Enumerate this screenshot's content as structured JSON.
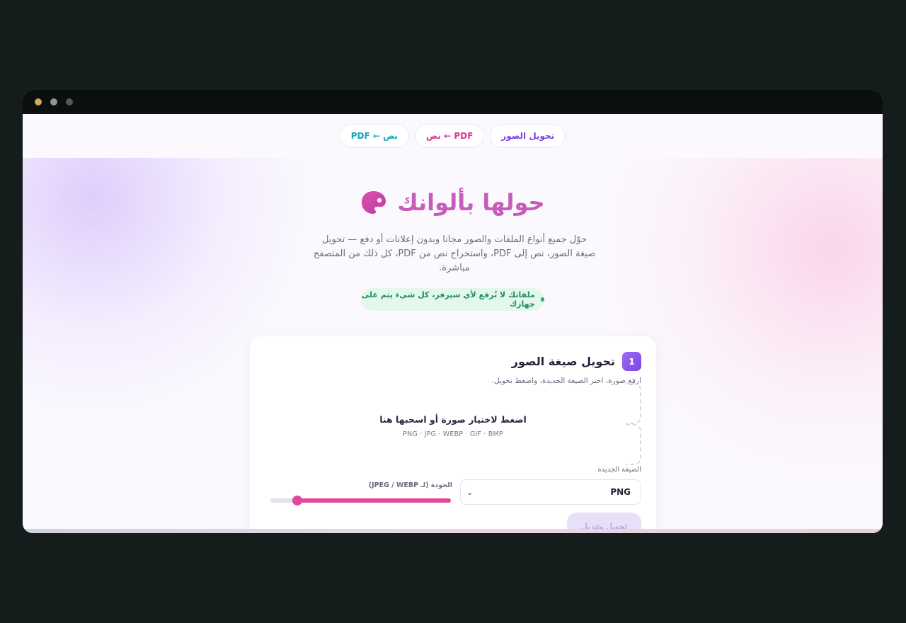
{
  "nav": {
    "tabs": [
      {
        "label": "تحويل الصور"
      },
      {
        "label": "نص ← PDF"
      },
      {
        "label": "PDF ← نص"
      }
    ]
  },
  "hero": {
    "title": "حولها بألوانك",
    "subtitle": "حوّل جميع أنواع الملفات والصور مجانا وبدون إعلانات أو دفع — تحويل صيغة الصور، نص إلى PDF، واستخراج نص من PDF، كل ذلك من المتصفح مباشرة.",
    "privacy_note": "ملفاتك لا تُرفع لأي سيرفر، كل شيء يتم على جهازك"
  },
  "card": {
    "step": "1",
    "title": "تحويل صيغة الصور",
    "description": "ارفع صورة، اختر الصيغة الجديدة، واضغط تحويل.",
    "dropzone_title": "اضغط لاختيار صورة أو اسحبها هنا",
    "dropzone_formats": "PNG · JPG · WEBP · GIF · BMP",
    "format_label": "الصيغة الجديدة",
    "format_value": "PNG",
    "quality_label": "الجودة (لـ JPEG / WEBP)",
    "quality_value": 0.85,
    "convert_label": "تحويل وتنزيل"
  },
  "colors": {
    "accent_purple": "#7b3fe4",
    "accent_pink": "#e2479a",
    "accent_teal": "#1ba6b8",
    "success_green": "#1e8f5d"
  },
  "icons": {
    "hero": "palette-icon",
    "select": "chevron-down-icon"
  }
}
